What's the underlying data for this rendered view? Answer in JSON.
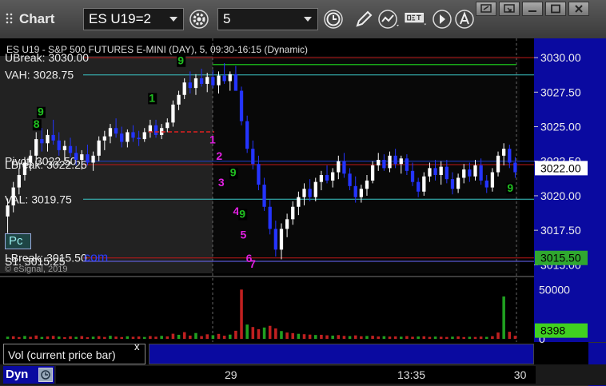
{
  "window": {
    "title": "Chart",
    "symbol": "ES U19=2",
    "interval": "5"
  },
  "chart": {
    "header": "ES U19 - S&P 500 FUTURES E-MINI (DAY), 5, 09:30-16:15 (Dynamic)",
    "header_prefix": "UBreak: 3030.00",
    "watermark": "© eSignal, 2019",
    "watermark_logo": "com",
    "pc_button": "Pc"
  },
  "levels": [
    {
      "label": "UBreak: 3030.00",
      "value": 3030.0,
      "color": "#c01818"
    },
    {
      "label": "VAH: 3028.75",
      "value": 3028.75,
      "color": "#3ac8c8"
    },
    {
      "label": "Pivot: 3022.50",
      "value": 3022.5,
      "color": "#2040d0"
    },
    {
      "label": "LBreak: 3022.25",
      "value": 3022.25,
      "color": "#c01818"
    },
    {
      "label": "VAL: 3019.75",
      "value": 3019.75,
      "color": "#3ac8c8"
    },
    {
      "label": "LBreak: 3015.50",
      "value": 3015.5,
      "color": "#c01818"
    },
    {
      "label": "S1: 3015.25",
      "value": 3015.25,
      "color": "#6a6aff"
    }
  ],
  "green_line": {
    "value": 3029.5,
    "color": "#18a818"
  },
  "price_axis": {
    "ticks": [
      "3030.00",
      "3027.50",
      "3025.00",
      "3022.50",
      "3020.00",
      "3017.50",
      "3015.00"
    ],
    "tick_values": [
      3030.0,
      3027.5,
      3025.0,
      3022.5,
      3020.0,
      3017.5,
      3015.0
    ],
    "current_price": "3022.00",
    "current_price_value": 3022.0,
    "level_tag": "3015.50",
    "level_tag_value": 3015.5,
    "ylim": [
      3014.5,
      3030.7
    ]
  },
  "volume": {
    "label": "Vol (current price bar)",
    "close": "x",
    "ticks": [
      "50000",
      "0"
    ],
    "current": "8398",
    "max": 60000
  },
  "time_axis": {
    "ticks": [
      {
        "label": "29",
        "frac": 0.365
      },
      {
        "label": "13:35",
        "frac": 0.725
      },
      {
        "label": "30",
        "frac": 0.968
      }
    ]
  },
  "bottom": {
    "dyn": "Dyn"
  },
  "td_counts": [
    {
      "label": "1",
      "color": "#e020e0",
      "frac": 0.405,
      "price": 3023.8
    },
    {
      "label": "2",
      "color": "#e020e0",
      "frac": 0.418,
      "price": 3022.6
    },
    {
      "label": "3",
      "color": "#e020e0",
      "frac": 0.422,
      "price": 3020.7
    },
    {
      "label": "4",
      "color": "#e020e0",
      "frac": 0.451,
      "price": 3018.6
    },
    {
      "label": "5",
      "color": "#e020e0",
      "frac": 0.465,
      "price": 3016.9
    },
    {
      "label": "6",
      "color": "#e020e0",
      "frac": 0.476,
      "price": 3015.2
    },
    {
      "label": "7",
      "color": "#e020e0",
      "frac": 0.483,
      "price": 3014.8
    },
    {
      "label": "1",
      "color": "#20c020",
      "frac": 0.287,
      "price": 3026.8
    },
    {
      "label": "9",
      "color": "#20c020",
      "frac": 0.343,
      "price": 3029.5
    },
    {
      "label": "9",
      "color": "#20c020",
      "frac": 0.07,
      "price": 3025.8
    },
    {
      "label": "8",
      "color": "#20c020",
      "frac": 0.062,
      "price": 3024.9
    },
    {
      "label": "9",
      "color": "#20c020",
      "frac": 0.445,
      "price": 3021.4
    },
    {
      "label": "9",
      "color": "#20c020",
      "frac": 0.985,
      "price": 3020.3
    },
    {
      "label": "9",
      "color": "#20c020",
      "frac": 0.463,
      "price": 3018.4
    }
  ],
  "colors": {
    "bull": "#ffffff",
    "bear": "#2434ff",
    "volume_bar": "#c02020",
    "volume_bar_green": "#20a020",
    "axis_bg": "#0a0aa0",
    "accent": "#ff00ff"
  },
  "chart_data": {
    "type": "candlestick",
    "series": [
      {
        "name": "ES U19",
        "ohlc": [
          [
            3018.5,
            3019.8,
            3017.3,
            3019.3
          ],
          [
            3019.3,
            3021.0,
            3018.8,
            3020.6
          ],
          [
            3020.6,
            3022.0,
            3020.1,
            3021.5
          ],
          [
            3021.5,
            3022.8,
            3021.1,
            3022.4
          ],
          [
            3022.4,
            3023.3,
            3021.8,
            3022.9
          ],
          [
            3022.9,
            3024.6,
            3022.4,
            3024.1
          ],
          [
            3024.1,
            3024.9,
            3023.2,
            3023.8
          ],
          [
            3023.8,
            3024.8,
            3023.2,
            3024.4
          ],
          [
            3024.4,
            3025.5,
            3023.7,
            3024.0
          ],
          [
            3024.0,
            3024.6,
            3022.9,
            3023.3
          ],
          [
            3023.3,
            3024.0,
            3022.5,
            3023.6
          ],
          [
            3023.6,
            3024.2,
            3022.8,
            3023.1
          ],
          [
            3023.1,
            3023.6,
            3022.2,
            3022.6
          ],
          [
            3022.6,
            3023.3,
            3021.9,
            3023.0
          ],
          [
            3023.0,
            3023.7,
            3022.2,
            3022.4
          ],
          [
            3022.4,
            3023.2,
            3021.8,
            3022.9
          ],
          [
            3022.9,
            3024.3,
            3022.5,
            3024.0
          ],
          [
            3024.0,
            3024.7,
            3023.3,
            3024.3
          ],
          [
            3024.3,
            3025.2,
            3023.8,
            3024.9
          ],
          [
            3024.9,
            3025.6,
            3024.2,
            3024.5
          ],
          [
            3024.5,
            3025.0,
            3023.5,
            3023.9
          ],
          [
            3023.9,
            3024.8,
            3023.5,
            3024.6
          ],
          [
            3024.6,
            3025.1,
            3023.9,
            3024.2
          ],
          [
            3024.2,
            3024.7,
            3023.6,
            3024.1
          ],
          [
            3024.1,
            3024.9,
            3023.9,
            3024.6
          ],
          [
            3024.6,
            3025.5,
            3024.2,
            3025.1
          ],
          [
            3025.1,
            3025.5,
            3024.2,
            3024.4
          ],
          [
            3024.4,
            3025.2,
            3024.1,
            3024.9
          ],
          [
            3024.9,
            3025.6,
            3024.6,
            3025.3
          ],
          [
            3025.3,
            3026.9,
            3025.0,
            3026.6
          ],
          [
            3026.6,
            3027.6,
            3026.2,
            3027.3
          ],
          [
            3027.3,
            3028.5,
            3027.0,
            3028.2
          ],
          [
            3028.2,
            3029.0,
            3027.4,
            3027.8
          ],
          [
            3027.8,
            3028.8,
            3027.3,
            3028.5
          ],
          [
            3028.5,
            3029.2,
            3027.9,
            3028.1
          ],
          [
            3028.1,
            3028.9,
            3027.5,
            3028.6
          ],
          [
            3028.6,
            3029.1,
            3027.8,
            3028.0
          ],
          [
            3028.0,
            3029.0,
            3027.4,
            3028.7
          ],
          [
            3028.7,
            3029.6,
            3028.1,
            3028.3
          ],
          [
            3028.3,
            3029.0,
            3027.6,
            3028.8
          ],
          [
            3028.8,
            3029.4,
            3027.9,
            3027.6
          ],
          [
            3027.6,
            3027.9,
            3025.1,
            3025.4
          ],
          [
            3025.4,
            3025.8,
            3023.1,
            3023.4
          ],
          [
            3023.4,
            3024.0,
            3021.9,
            3022.3
          ],
          [
            3022.3,
            3022.9,
            3020.4,
            3020.8
          ],
          [
            3020.8,
            3021.3,
            3018.9,
            3019.2
          ],
          [
            3019.2,
            3019.7,
            3017.2,
            3017.6
          ],
          [
            3017.6,
            3018.2,
            3015.6,
            3016.1
          ],
          [
            3016.1,
            3018.0,
            3015.4,
            3017.6
          ],
          [
            3017.6,
            3018.7,
            3017.0,
            3018.3
          ],
          [
            3018.3,
            3019.6,
            3017.9,
            3019.2
          ],
          [
            3019.2,
            3020.3,
            3018.6,
            3019.9
          ],
          [
            3019.9,
            3020.9,
            3019.3,
            3020.5
          ],
          [
            3020.5,
            3021.2,
            3019.6,
            3019.9
          ],
          [
            3019.9,
            3021.3,
            3019.6,
            3021.0
          ],
          [
            3021.0,
            3021.8,
            3020.4,
            3021.5
          ],
          [
            3021.5,
            3022.2,
            3020.9,
            3021.1
          ],
          [
            3021.1,
            3022.0,
            3020.6,
            3021.7
          ],
          [
            3021.7,
            3022.9,
            3021.2,
            3022.5
          ],
          [
            3022.5,
            3023.1,
            3021.3,
            3021.6
          ],
          [
            3021.6,
            3022.0,
            3020.4,
            3020.7
          ],
          [
            3020.7,
            3021.4,
            3019.5,
            3019.9
          ],
          [
            3019.9,
            3020.8,
            3019.5,
            3020.5
          ],
          [
            3020.5,
            3021.5,
            3020.0,
            3021.1
          ],
          [
            3021.1,
            3022.5,
            3020.9,
            3022.2
          ],
          [
            3022.2,
            3023.1,
            3021.8,
            3022.6
          ],
          [
            3022.6,
            3023.0,
            3021.8,
            3022.0
          ],
          [
            3022.0,
            3023.2,
            3021.7,
            3022.9
          ],
          [
            3022.9,
            3023.4,
            3022.0,
            3022.3
          ],
          [
            3022.3,
            3022.9,
            3021.6,
            3022.7
          ],
          [
            3022.7,
            3023.0,
            3021.5,
            3021.8
          ],
          [
            3021.8,
            3022.4,
            3020.7,
            3021.0
          ],
          [
            3021.0,
            3021.3,
            3019.9,
            3020.3
          ],
          [
            3020.3,
            3021.7,
            3020.0,
            3021.4
          ],
          [
            3021.4,
            3022.4,
            3021.0,
            3022.0
          ],
          [
            3022.0,
            3022.6,
            3021.1,
            3021.5
          ],
          [
            3021.5,
            3022.5,
            3020.8,
            3022.1
          ],
          [
            3022.1,
            3022.6,
            3020.9,
            3021.2
          ],
          [
            3021.2,
            3021.7,
            3020.1,
            3020.5
          ],
          [
            3020.5,
            3021.6,
            3020.2,
            3021.3
          ],
          [
            3021.3,
            3022.3,
            3020.9,
            3021.9
          ],
          [
            3021.9,
            3022.4,
            3021.0,
            3021.4
          ],
          [
            3021.4,
            3022.6,
            3021.1,
            3022.2
          ],
          [
            3022.2,
            3022.7,
            3020.8,
            3021.1
          ],
          [
            3021.1,
            3021.5,
            3020.2,
            3020.6
          ],
          [
            3020.6,
            3022.0,
            3020.3,
            3021.7
          ],
          [
            3021.7,
            3023.2,
            3021.4,
            3022.9
          ],
          [
            3022.9,
            3023.8,
            3022.2,
            3023.4
          ],
          [
            3023.4,
            3023.7,
            3022.0,
            3022.4
          ],
          [
            3022.4,
            3022.8,
            3021.3,
            3021.7
          ]
        ]
      }
    ],
    "volume": [
      2200,
      2600,
      1800,
      2900,
      2100,
      3400,
      1900,
      2400,
      3000,
      2300,
      1700,
      2500,
      2000,
      2800,
      1600,
      2200,
      2700,
      1900,
      3100,
      2300,
      1800,
      2600,
      2100,
      2400,
      1900,
      2800,
      2200,
      3000,
      2500,
      5200,
      4100,
      6800,
      3300,
      5900,
      2800,
      4600,
      3700,
      5000,
      3200,
      4300,
      8200,
      18000,
      14500,
      12000,
      9800,
      11500,
      13200,
      10600,
      7900,
      6400,
      5800,
      5100,
      4700,
      4300,
      3900,
      4100,
      3600,
      3300,
      3800,
      3000,
      2800,
      3500,
      2600,
      2900,
      3100,
      2400,
      2700,
      2300,
      2500,
      2200,
      2800,
      2100,
      2400,
      2600,
      2000,
      2300,
      2100,
      1900,
      2200,
      2500,
      1800,
      2100,
      1900,
      2300,
      2000,
      2700,
      6400,
      14500,
      7200,
      3100
    ],
    "volume_spikes": [
      {
        "index": 41,
        "value": 50000
      },
      {
        "index": 87,
        "value": 43000
      }
    ],
    "ylim": [
      3014.5,
      3030.7
    ]
  }
}
